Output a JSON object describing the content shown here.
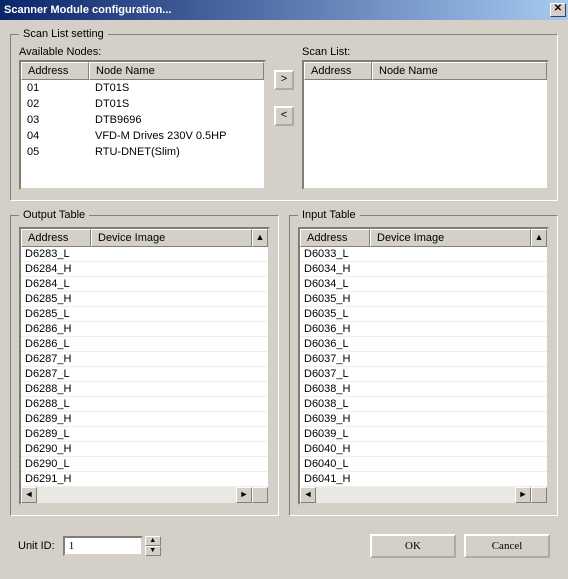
{
  "window": {
    "title": "Scanner Module configuration...",
    "close_label": "✕"
  },
  "scanListGroup": {
    "legend": "Scan List setting",
    "availableLabel": "Available Nodes:",
    "scanListLabel": "Scan List:",
    "headers": {
      "address": "Address",
      "nodeName": "Node Name"
    },
    "addBtn": ">",
    "removeBtn": "<",
    "availableNodes": [
      {
        "address": "01",
        "name": "DT01S"
      },
      {
        "address": "02",
        "name": "DT01S"
      },
      {
        "address": "03",
        "name": "DTB9696"
      },
      {
        "address": "04",
        "name": "VFD-M Drives 230V 0.5HP"
      },
      {
        "address": "05",
        "name": "RTU-DNET(Slim)"
      }
    ],
    "scanList": []
  },
  "outputTable": {
    "legend": "Output Table",
    "headers": {
      "address": "Address",
      "deviceImage": "Device Image"
    },
    "rows": [
      {
        "address": "D6283_L",
        "image": ""
      },
      {
        "address": "D6284_H",
        "image": ""
      },
      {
        "address": "D6284_L",
        "image": ""
      },
      {
        "address": "D6285_H",
        "image": ""
      },
      {
        "address": "D6285_L",
        "image": ""
      },
      {
        "address": "D6286_H",
        "image": ""
      },
      {
        "address": "D6286_L",
        "image": ""
      },
      {
        "address": "D6287_H",
        "image": ""
      },
      {
        "address": "D6287_L",
        "image": ""
      },
      {
        "address": "D6288_H",
        "image": ""
      },
      {
        "address": "D6288_L",
        "image": ""
      },
      {
        "address": "D6289_H",
        "image": ""
      },
      {
        "address": "D6289_L",
        "image": ""
      },
      {
        "address": "D6290_H",
        "image": ""
      },
      {
        "address": "D6290_L",
        "image": ""
      },
      {
        "address": "D6291_H",
        "image": ""
      }
    ]
  },
  "inputTable": {
    "legend": "Input Table",
    "headers": {
      "address": "Address",
      "deviceImage": "Device Image"
    },
    "rows": [
      {
        "address": "D6033_L",
        "image": ""
      },
      {
        "address": "D6034_H",
        "image": ""
      },
      {
        "address": "D6034_L",
        "image": ""
      },
      {
        "address": "D6035_H",
        "image": ""
      },
      {
        "address": "D6035_L",
        "image": ""
      },
      {
        "address": "D6036_H",
        "image": ""
      },
      {
        "address": "D6036_L",
        "image": ""
      },
      {
        "address": "D6037_H",
        "image": ""
      },
      {
        "address": "D6037_L",
        "image": ""
      },
      {
        "address": "D6038_H",
        "image": ""
      },
      {
        "address": "D6038_L",
        "image": ""
      },
      {
        "address": "D6039_H",
        "image": ""
      },
      {
        "address": "D6039_L",
        "image": ""
      },
      {
        "address": "D6040_H",
        "image": ""
      },
      {
        "address": "D6040_L",
        "image": ""
      },
      {
        "address": "D6041_H",
        "image": ""
      }
    ]
  },
  "footer": {
    "unitIdLabel": "Unit ID:",
    "unitIdValue": "1",
    "okLabel": "OK",
    "cancelLabel": "Cancel"
  },
  "glyphs": {
    "upTriangle": "▲",
    "downTriangle": "▼",
    "leftTriangle": "◄",
    "rightTriangle": "►"
  }
}
